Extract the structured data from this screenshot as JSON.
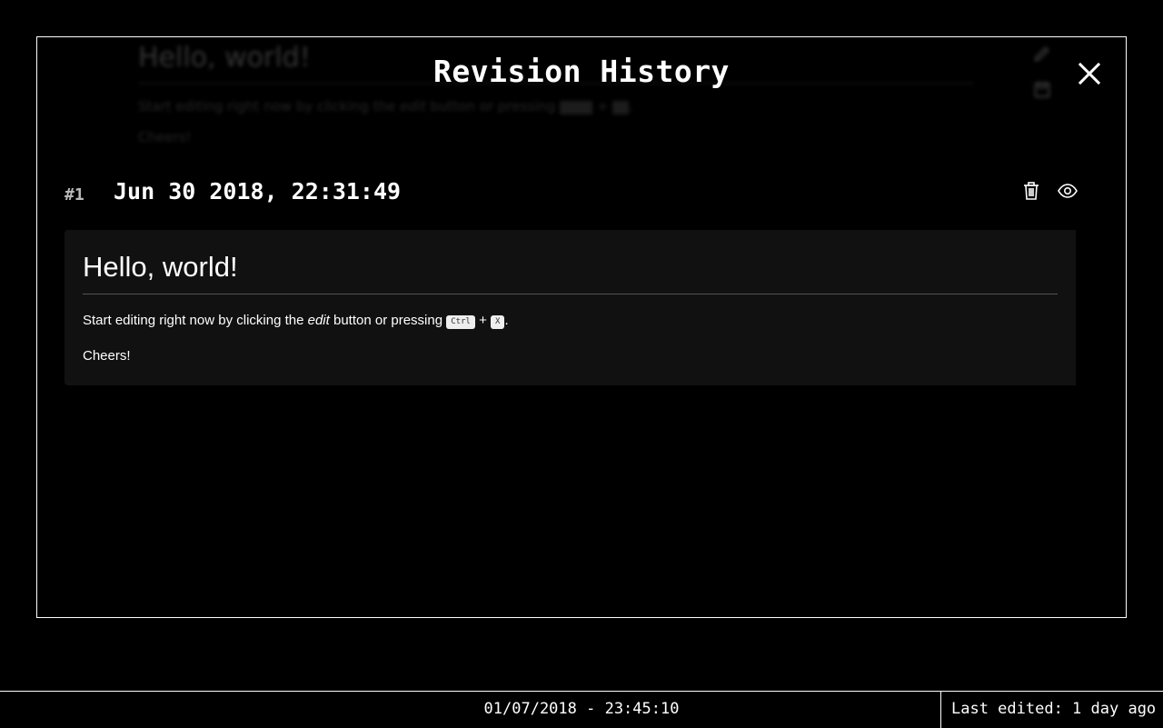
{
  "background_document": {
    "title": "Hello, world!",
    "paragraph_prefix": "Start editing right now by clicking the ",
    "paragraph_em": "edit",
    "paragraph_mid": " button or pressing ",
    "key1": "Ctrl",
    "plus": " + ",
    "key2": "X",
    "paragraph_end": ".",
    "closing": "Cheers!"
  },
  "modal": {
    "title": "Revision History",
    "close_icon": "close-icon"
  },
  "revisions": [
    {
      "number": "#1",
      "date": "Jun 30 2018, 22:31:49",
      "delete_icon": "trash-icon",
      "view_icon": "eye-icon",
      "preview": {
        "title": "Hello, world!",
        "paragraph_prefix": "Start editing right now by clicking the ",
        "paragraph_em": "edit",
        "paragraph_mid": " button or pressing ",
        "key1": "Ctrl",
        "plus": " + ",
        "key2": "X",
        "paragraph_end": ".",
        "closing": "Cheers!"
      }
    }
  ],
  "status_bar": {
    "datetime": "01/07/2018 - 23:45:10",
    "last_edited": "Last edited: 1 day ago"
  },
  "colors": {
    "background": "#000000",
    "foreground": "#ffffff",
    "preview_background": "#111111"
  }
}
